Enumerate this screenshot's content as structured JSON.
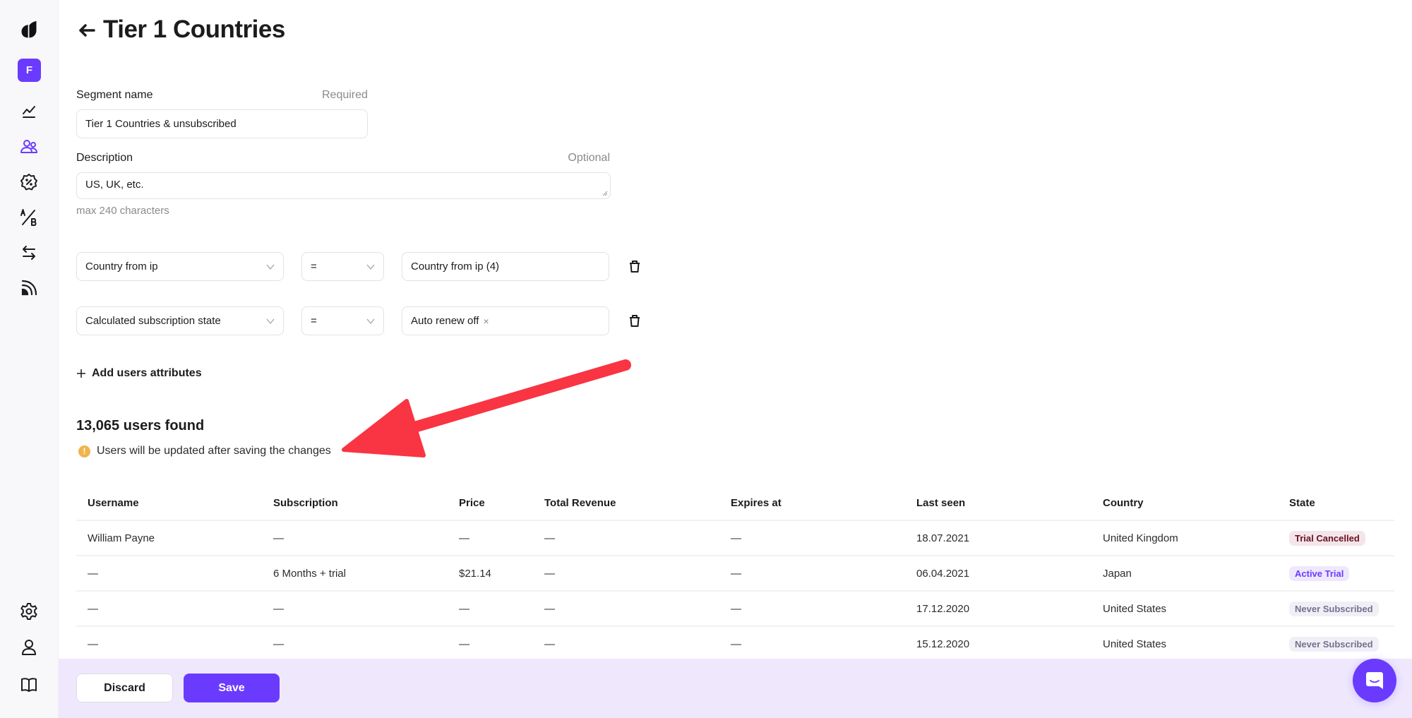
{
  "colors": {
    "accent": "#6a3bff",
    "footer_bg": "#efe8fd",
    "annotation_arrow": "#f93443",
    "warning": "#f0b44c"
  },
  "sidebar": {
    "logo": "brand-logo",
    "workspace_initial": "F",
    "items": [
      {
        "name": "analytics",
        "icon": "chart-line-icon",
        "active": false
      },
      {
        "name": "segments",
        "icon": "users-icon",
        "active": true
      },
      {
        "name": "promotions",
        "icon": "discount-badge-icon",
        "active": false
      },
      {
        "name": "ab-tests",
        "icon": "ab-test-icon",
        "active": false
      },
      {
        "name": "integrations",
        "icon": "transfer-arrows-icon",
        "active": false
      },
      {
        "name": "feed",
        "icon": "rss-icon",
        "active": false
      }
    ],
    "bottom_items": [
      {
        "name": "settings",
        "icon": "gear-icon"
      },
      {
        "name": "account",
        "icon": "user-icon"
      },
      {
        "name": "docs",
        "icon": "book-icon"
      }
    ]
  },
  "header": {
    "title": "Tier 1 Countries",
    "back_icon": "arrow-left-icon"
  },
  "form": {
    "segment_name": {
      "label": "Segment name",
      "hint": "Required",
      "value": "Tier 1 Countries & unsubscribed"
    },
    "description": {
      "label": "Description",
      "hint": "Optional",
      "value": "US, UK, etc.",
      "helper": "max 240 characters"
    },
    "filters": [
      {
        "attribute": "Country from ip",
        "operator": "=",
        "value": "Country from ip (4)",
        "removable_tag": false
      },
      {
        "attribute": "Calculated subscription state",
        "operator": "=",
        "value": "Auto renew off",
        "removable_tag": true
      }
    ],
    "tag_remove_symbol": "×",
    "add_attribute_label": "Add users attributes"
  },
  "results": {
    "count_label": "13,065 users found",
    "warning_symbol": "!",
    "warning_text": "Users will be updated after saving the changes"
  },
  "table": {
    "columns": [
      "Username",
      "Subscription",
      "Price",
      "Total Revenue",
      "Expires at",
      "Last seen",
      "Country",
      "State"
    ],
    "rows": [
      {
        "cells": [
          "William Payne",
          "—",
          "—",
          "—",
          "—",
          "18.07.2021",
          "United Kingdom"
        ],
        "state": {
          "label": "Trial Cancelled",
          "fg": "#6b0f1f",
          "bg": "#f3e6ea"
        }
      },
      {
        "cells": [
          "—",
          "6 Months + trial",
          "$21.14",
          "—",
          "—",
          "06.04.2021",
          "Japan"
        ],
        "state": {
          "label": "Active Trial",
          "fg": "#6a3bff",
          "bg": "#efe8fd"
        }
      },
      {
        "cells": [
          "—",
          "—",
          "—",
          "—",
          "—",
          "17.12.2020",
          "United States"
        ],
        "state": {
          "label": "Never Subscribed",
          "fg": "#77708f",
          "bg": "#f1eff6"
        }
      },
      {
        "cells": [
          "—",
          "—",
          "—",
          "—",
          "—",
          "15.12.2020",
          "United States"
        ],
        "state": {
          "label": "Never Subscribed",
          "fg": "#77708f",
          "bg": "#f1eff6"
        }
      }
    ]
  },
  "footer": {
    "discard_label": "Discard",
    "save_label": "Save"
  },
  "chat_widget": {
    "icon": "chat-bubble-icon"
  }
}
